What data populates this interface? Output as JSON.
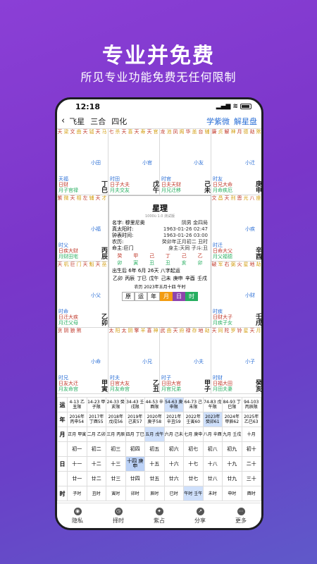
{
  "promo": {
    "title": "专业并免费",
    "subtitle": "所见专业功能免费无任何限制"
  },
  "status": {
    "time": "12:18",
    "signal": "▂▄▆",
    "wifi": "≋"
  },
  "nav": {
    "back": "‹",
    "tabs": [
      "飞星",
      "三合",
      "四化"
    ],
    "links": [
      "学紫微",
      "解星盘"
    ]
  },
  "palaces": [
    {
      "stars": [
        "天",
        "文",
        "天",
        "天",
        "天"
      ],
      "stars2": [
        "梁",
        "曲",
        "钺",
        "马",
        "贵"
      ],
      "mid": "小田",
      "r1": "天福",
      "r2": "日财",
      "r3": "月子官禄",
      "gz": "丁巳"
    },
    {
      "stars": [
        "七",
        "天",
        "天",
        "天"
      ],
      "stars2": [
        "杀",
        "喜",
        "寿",
        "官"
      ],
      "mid": "小官",
      "r1": "时田",
      "r2": "日子大夫",
      "r3": "月夫交友",
      "gz": "戊午"
    },
    {
      "stars": [
        "龙",
        "凤",
        "华",
        "台"
      ],
      "stars2": [
        "池",
        "阁",
        "盖",
        "辅"
      ],
      "mid": "小友",
      "r1": "时官",
      "r2": "日夫天财",
      "r3": "月兄迁移",
      "gz": "己未"
    },
    {
      "stars": [
        "廉",
        "解",
        "月",
        "劫",
        "大"
      ],
      "stars2": [
        "贞",
        "神",
        "德",
        "煞",
        "耗"
      ],
      "mid": "小迁",
      "r1": "时友",
      "r2": "日兄大命",
      "r3": "月命疾厄",
      "gz": "庚申"
    },
    {
      "stars": [
        "紫",
        "天",
        "左",
        "天",
        "天"
      ],
      "stars2": [
        "微",
        "相",
        "辅",
        "才",
        "空"
      ],
      "mid": "小福",
      "r1": "时父",
      "r2": "日疾大财",
      "r3": "月财田宅",
      "gz": "丙辰"
    },
    {
      "stars": [
        "文",
        "天",
        "恩",
        "八",
        "天"
      ],
      "stars2": [
        "昌",
        "刑",
        "光",
        "座",
        "虚"
      ],
      "mid": "小疾",
      "r1": "时迁",
      "r2": "日命大父",
      "r3": "月父福德",
      "gz": "辛酉"
    },
    {
      "stars": [
        "天",
        "巨",
        "天",
        "天",
        "天"
      ],
      "stars2": [
        "机",
        "门",
        "魁",
        "巫",
        "哭"
      ],
      "mid": "小父",
      "r1": "时命",
      "r2": "日迁大疾",
      "r3": "月迁父母",
      "gz": "乙卯"
    },
    {
      "stars": [
        "破",
        "右",
        "火",
        "地",
        "天"
      ],
      "stars2": [
        "军",
        "弼",
        "星",
        "劫",
        "厨"
      ],
      "mid": "小财",
      "r1": "时疾",
      "r2": "日财大子",
      "r3": "月疾子女",
      "gz": "壬戌"
    },
    {
      "stars": [
        "贪",
        "阴",
        "狼",
        "煞"
      ],
      "stars2": [
        "",
        "",
        "",
        ""
      ],
      "mid": "小命",
      "r1": "时兄",
      "r2": "日友大迁",
      "r3": "月友命宫",
      "gz": "甲寅"
    },
    {
      "stars": [
        "太",
        "太",
        "擎",
        "喜",
        "天"
      ],
      "stars2": [
        "阳",
        "阴",
        "羊",
        "神",
        "哭"
      ],
      "mid": "小兄",
      "r1": "时夫",
      "r2": "日官大友",
      "r3": "月友命宫",
      "gz": "乙丑"
    },
    {
      "stars": [
        "武",
        "天",
        "禄",
        "地",
        "红"
      ],
      "stars2": [
        "曲",
        "府",
        "存",
        "劫",
        "鸾"
      ],
      "mid": "小夫",
      "r1": "时子",
      "r2": "日田大官",
      "r3": "月官兄弟",
      "gz": "甲子"
    },
    {
      "stars": [
        "天",
        "陀",
        "铃",
        "天",
        "天"
      ],
      "stars2": [
        "同",
        "罗",
        "星",
        "月",
        "虚"
      ],
      "mid": "小子",
      "r1": "时财",
      "r2": "日福大田",
      "r3": "月田夫妻",
      "gz": "癸亥"
    }
  ],
  "center": {
    "title": "星理",
    "version": "1000ü 1.0 测试版",
    "rows": [
      {
        "k": "名字: 穆里尼奥",
        "v": "阴男   金四局"
      },
      {
        "k": "真太阳时:",
        "v": "1963-01-26  02:47"
      },
      {
        "k": "钟表时间:",
        "v": "1963-01-26  03:00"
      },
      {
        "k": "农历:",
        "v": "癸卯年正月初二 丑时"
      },
      {
        "k": "命主:巨门",
        "v": "身主:天同  子斗:丑"
      }
    ],
    "bazi_label": "八字",
    "bazi": [
      "癸",
      "甲",
      "己",
      "丁",
      "己",
      "乙"
    ],
    "bazi2": [
      "卯",
      "寅",
      "丑",
      "丑",
      "亥",
      "卯"
    ],
    "born": "出生后 6年 6月 26天   八字起运",
    "dayun": [
      "乙卯",
      "丙辰",
      "丁巳",
      "戊午",
      "己未",
      "庚申",
      "辛酉",
      "壬戌"
    ],
    "lunar": "农历 2023年五月十四 午时",
    "seg": [
      "原",
      "运",
      "年",
      "月",
      "日",
      "时"
    ]
  },
  "calendar": {
    "yun_label": "运",
    "yun": [
      "4-13 乙丑限",
      "14-23 甲子限",
      "24-33 癸亥限",
      "34-43 壬戌限",
      "44-53 辛酉限",
      "54-63 庚申限",
      "64-73 己未限",
      "74-83 戊午限",
      "84-93 丁巳限",
      "94-103 丙辰限"
    ],
    "nian_label": "年",
    "nian": [
      "2016年 丙申54",
      "2017年 丁酉55",
      "2018年 戊戌56",
      "2019年 己亥57",
      "2020年 庚子58",
      "2021年 辛丑59",
      "2022年 壬寅60",
      "2023年 癸卯61",
      "2024年 甲辰62",
      "2025年 乙巳63"
    ],
    "yue_label": "月",
    "yue": [
      "正月 甲寅",
      "二月 乙卯",
      "三月 丙辰",
      "四月 丁巳",
      "五月 戊午",
      "六月 己未",
      "七月 庚申",
      "八月 辛酉",
      "九月 壬戌",
      "十月"
    ],
    "ri_label": "日",
    "ri": [
      [
        "初一",
        "初二",
        "初三",
        "初四",
        "初五",
        "初六",
        "初七",
        "初八",
        "初九",
        "初十"
      ],
      [
        "十一",
        "十二",
        "十三",
        "十四 庚申",
        "十五",
        "十六",
        "十七",
        "十八",
        "十九",
        "二十"
      ],
      [
        "廿一",
        "廿二",
        "廿三",
        "廿四",
        "廿五",
        "廿六",
        "廿七",
        "廿八",
        "廿九",
        "三十"
      ]
    ],
    "shi_label": "时",
    "shi": [
      "子时",
      "丑时",
      "寅时",
      "卯时",
      "辰时",
      "巳时",
      "午时 壬午",
      "未时",
      "申时",
      "酉时"
    ]
  },
  "dock": [
    {
      "label": "隐私",
      "icon": "shield-icon"
    },
    {
      "label": "择时",
      "icon": "clock-icon"
    },
    {
      "label": "紫占",
      "icon": "star-icon"
    },
    {
      "label": "分享",
      "icon": "share-icon"
    },
    {
      "label": "更多",
      "icon": "more-icon"
    }
  ]
}
